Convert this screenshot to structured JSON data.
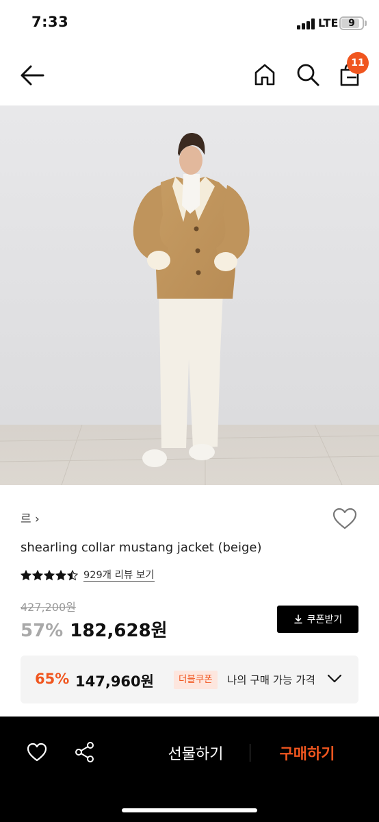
{
  "status_bar": {
    "time": "7:33",
    "network": "LTE",
    "battery": "9"
  },
  "nav": {
    "back_icon": "arrow-left-icon",
    "home_icon": "home-icon",
    "search_icon": "search-icon",
    "cart_icon": "shopping-bag-icon",
    "cart_count": "11"
  },
  "product": {
    "image_alt": "shearling collar mustang jacket (beige)",
    "brand": "르",
    "brand_chevron": "›",
    "title": "shearling collar mustang jacket (beige)",
    "rating": 4.5,
    "review_link": "929개 리뷰 보기",
    "original_price": "427,200원",
    "discount": "57%",
    "price": "182,628원",
    "coupon_button": "쿠폰받기"
  },
  "best_price": {
    "discount": "65%",
    "price": "147,960원",
    "tag": "더블쿠폰",
    "label": "나의 구매 가능 가격"
  },
  "bottom_bar": {
    "gift_label": "선물하기",
    "buy_label": "구매하기"
  },
  "colors": {
    "accent": "#f0561f",
    "dark": "#000000",
    "muted": "#a9a9a9"
  }
}
